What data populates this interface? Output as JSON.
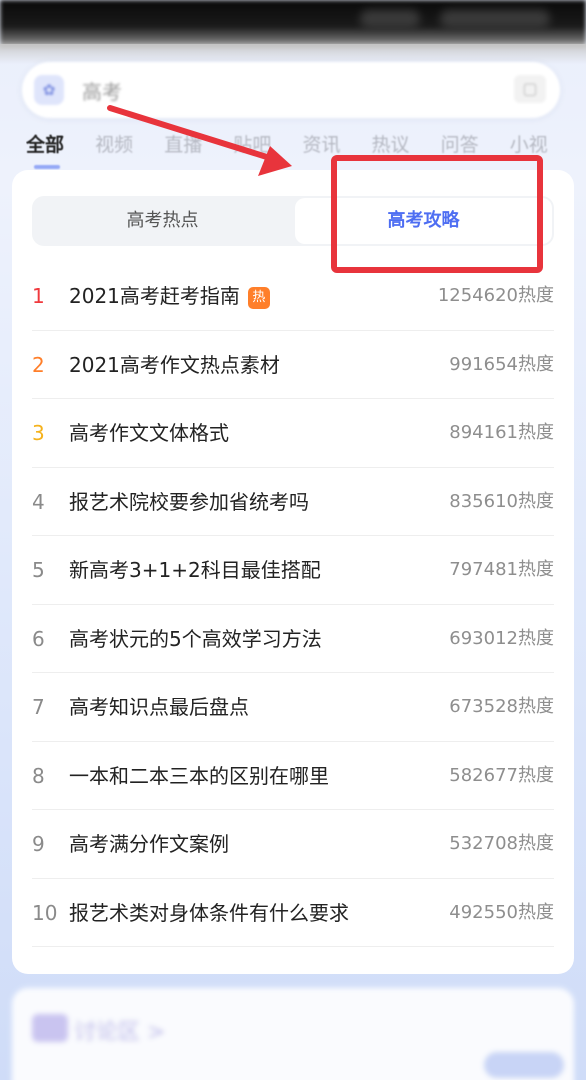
{
  "search": {
    "query": "高考",
    "logo_glyph": "✿",
    "camera_glyph": "▢"
  },
  "tabs": [
    {
      "label": "全部",
      "active": true
    },
    {
      "label": "视频"
    },
    {
      "label": "直播"
    },
    {
      "label": "贴吧"
    },
    {
      "label": "资讯"
    },
    {
      "label": "热议"
    },
    {
      "label": "问答"
    },
    {
      "label": "小视"
    }
  ],
  "segments": {
    "left": "高考热点",
    "right": "高考攻略",
    "selected": "right"
  },
  "hot_badge": "热",
  "items": [
    {
      "rank": "1",
      "title": "2021高考赶考指南",
      "heat": "1254620热度",
      "hot": true
    },
    {
      "rank": "2",
      "title": "2021高考作文热点素材",
      "heat": "991654热度"
    },
    {
      "rank": "3",
      "title": "高考作文文体格式",
      "heat": "894161热度"
    },
    {
      "rank": "4",
      "title": "报艺术院校要参加省统考吗",
      "heat": "835610热度"
    },
    {
      "rank": "5",
      "title": "新高考3+1+2科目最佳搭配",
      "heat": "797481热度"
    },
    {
      "rank": "6",
      "title": "高考状元的5个高效学习方法",
      "heat": "693012热度"
    },
    {
      "rank": "7",
      "title": "高考知识点最后盘点",
      "heat": "673528热度"
    },
    {
      "rank": "8",
      "title": "一本和二本三本的区别在哪里",
      "heat": "582677热度"
    },
    {
      "rank": "9",
      "title": "高考满分作文案例",
      "heat": "532708热度"
    },
    {
      "rank": "10",
      "title": "报艺术类对身体条件有什么要求",
      "heat": "492550热度"
    }
  ],
  "discuss": {
    "label": "讨论区 >"
  },
  "colors": {
    "accent": "#4e6ef2",
    "rank1": "#f0393d",
    "rank2": "#ff7f2a",
    "rank3": "#f5b21c",
    "annotation_red": "#e8343c"
  }
}
